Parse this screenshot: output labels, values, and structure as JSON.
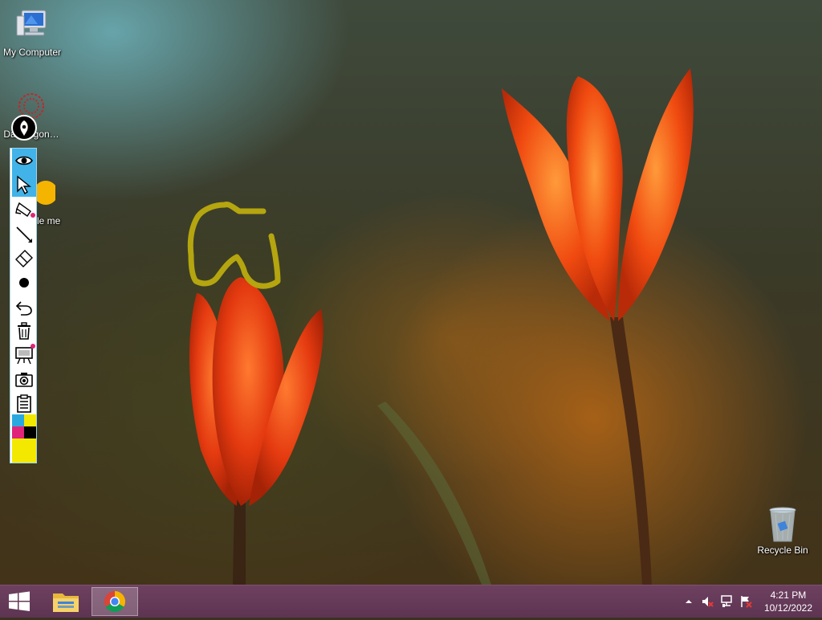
{
  "desktop": {
    "icons": [
      {
        "label": "My Computer",
        "icon": "computer-icon"
      },
      {
        "label": "Da… agon…",
        "icon": "dragon-icon"
      },
      {
        "label": "le me",
        "icon": "chrome-icon"
      },
      {
        "label": "Recycle Bin",
        "icon": "recycle-bin-icon"
      }
    ]
  },
  "annotation_toolbar": {
    "tools": [
      {
        "name": "eye-icon",
        "active": true
      },
      {
        "name": "cursor-icon",
        "active": true
      },
      {
        "name": "highlighter-icon",
        "active": false
      },
      {
        "name": "line-icon",
        "active": false
      },
      {
        "name": "eraser-icon",
        "active": false
      },
      {
        "name": "dot-icon",
        "active": false
      },
      {
        "name": "undo-icon",
        "active": false
      },
      {
        "name": "trash-icon",
        "active": false
      },
      {
        "name": "whiteboard-icon",
        "active": false
      },
      {
        "name": "camera-icon",
        "active": false
      },
      {
        "name": "clipboard-icon",
        "active": false
      }
    ],
    "palette": [
      "#29a8e0",
      "#f2e800",
      "#e0247a",
      "#000000"
    ],
    "selected_color": "#f2e800",
    "drawing_color": "#b5a50f"
  },
  "taskbar": {
    "pinned": [
      "windows-logo-icon",
      "file-explorer-icon",
      "chrome-icon"
    ],
    "tray": [
      "chevron-up-icon",
      "volume-muted-icon",
      "network-icon",
      "flag-icon"
    ],
    "clock": {
      "time": "4:21 PM",
      "date": "10/12/2022"
    }
  },
  "colors": {
    "taskbar": "#6e4060",
    "accent": "#41b3e8"
  }
}
